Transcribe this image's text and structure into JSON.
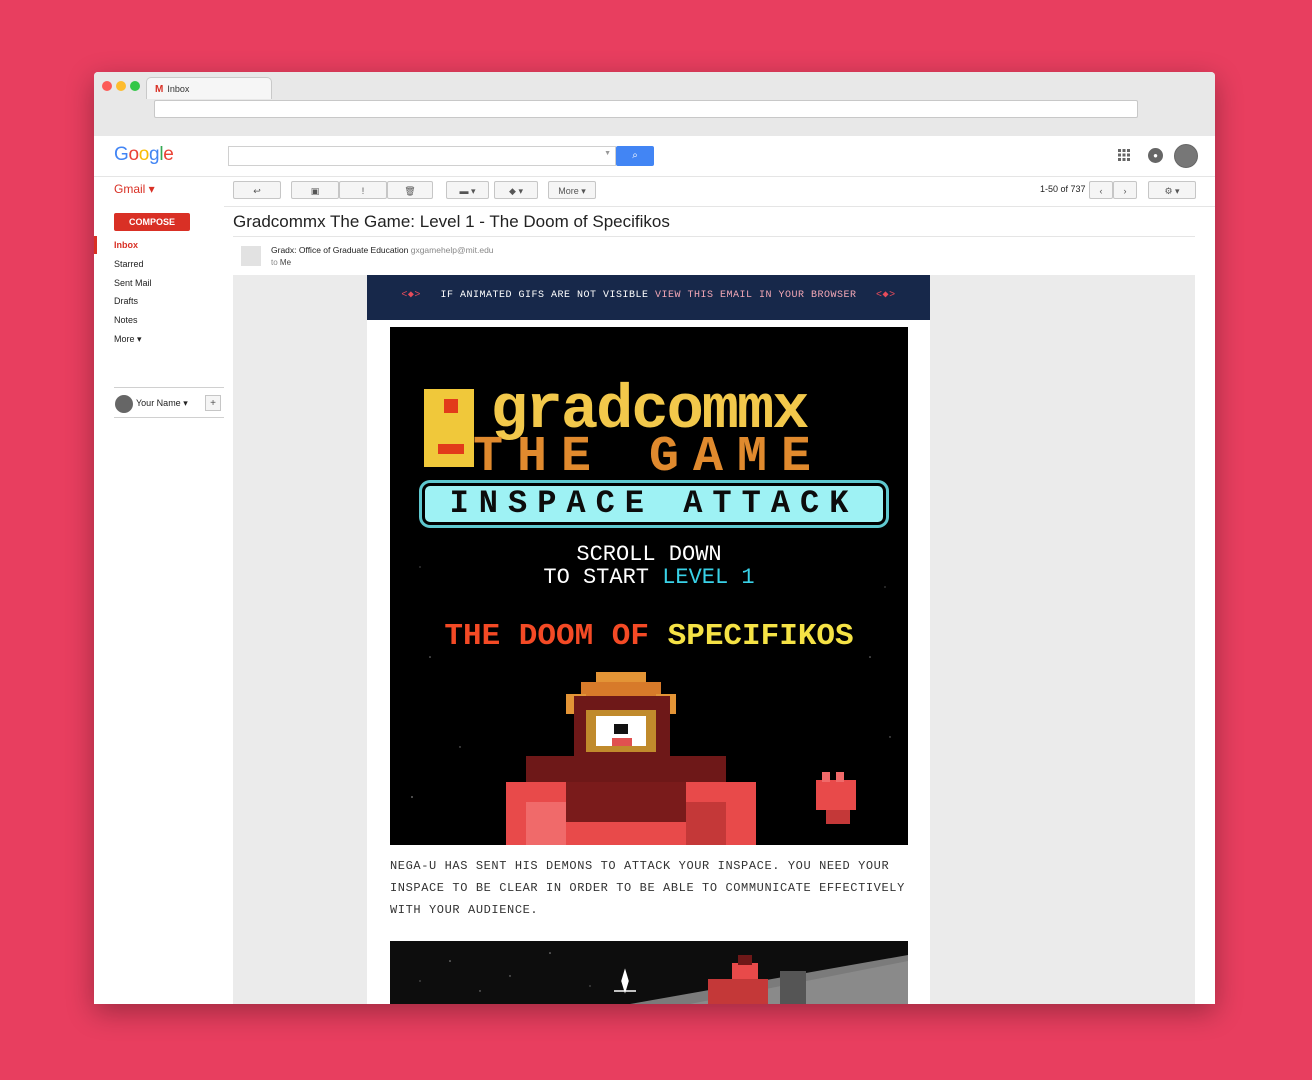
{
  "browser": {
    "tab_title": "Inbox",
    "tab_icon": "M"
  },
  "header": {
    "logo": "Google",
    "search_icon": "⌕",
    "apps_icon": "⋮⋮",
    "notif_icon": "●"
  },
  "toolbar": {
    "gmail_label": "Gmail ▾",
    "back_icon": "↩",
    "archive_icon": "▣",
    "spam_icon": "!",
    "delete_icon": "🗑",
    "folder_icon": "▬ ▾",
    "label_icon": "◆ ▾",
    "more_label": "More ▾",
    "count": "1-50 of 737",
    "prev_icon": "‹",
    "next_icon": "›",
    "settings_icon": "⚙ ▾"
  },
  "sidebar": {
    "compose": "COMPOSE",
    "items": [
      {
        "label": "Inbox"
      },
      {
        "label": "Starred"
      },
      {
        "label": "Sent Mail"
      },
      {
        "label": "Drafts"
      },
      {
        "label": "Notes"
      },
      {
        "label": "More ▾"
      }
    ],
    "user_name": "Your Name ▾",
    "add": "+"
  },
  "message": {
    "subject": "Gradcommx The Game: Level 1 - The Doom of Specifikos",
    "sender_name": "Gradx: Office of Graduate Education",
    "sender_email": "gxgamehelp@mit.edu",
    "to_prefix": "to",
    "to": "Me"
  },
  "email": {
    "banner_text": "IF ANIMATED GIFS ARE NOT VISIBLE",
    "banner_link": "VIEW THIS EMAIL IN YOUR BROWSER",
    "hero": {
      "title1": "gradcommx",
      "title2": "THE GAME",
      "subtitle": "INSPACE ATTACK",
      "scroll_line1": "SCROLL DOWN",
      "scroll_line2": "TO START",
      "level": "LEVEL 1",
      "doom_a": "THE DOOM OF",
      "doom_b": "SPECIFIKOS"
    },
    "body_text": "NEGA-U HAS SENT HIS DEMONS TO ATTACK YOUR INSPACE. YOU NEED YOUR INSPACE TO BE CLEAR IN ORDER TO BE ABLE TO COMMUNICATE EFFECTIVELY WITH YOUR AUDIENCE."
  },
  "colors": {
    "background": "#e83e5f",
    "accent": "#d93025",
    "banner": "#17284a",
    "link": "#f2a7b5"
  }
}
